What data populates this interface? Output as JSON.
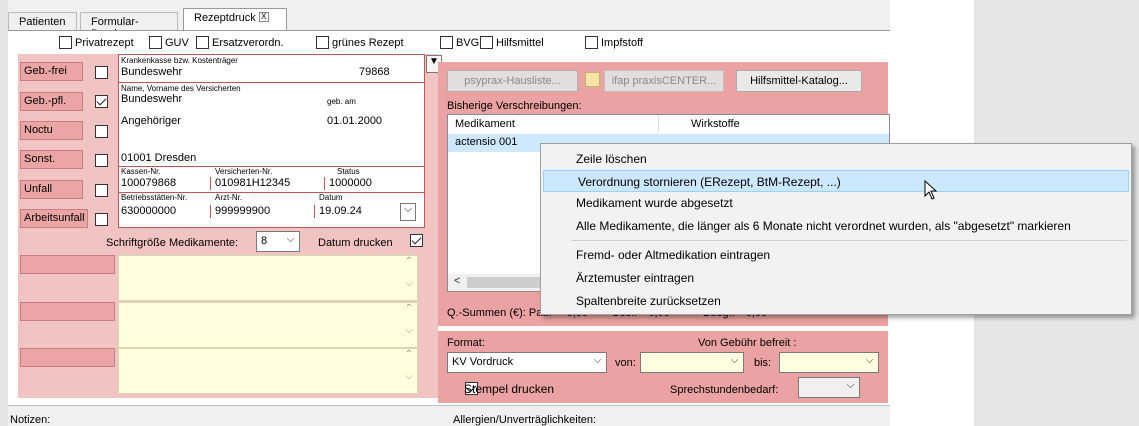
{
  "tabs": [
    "Patienten",
    "Formular-Druck",
    "Rezeptdruck"
  ],
  "tab_close": "X",
  "top_checks": [
    {
      "label": "Privatrezept",
      "checked": false
    },
    {
      "label": "GUV",
      "checked": false
    },
    {
      "label": "Ersatzverordn.",
      "checked": false
    },
    {
      "label": "grünes Rezept",
      "checked": false
    },
    {
      "label": "BVG",
      "checked": false
    },
    {
      "label": "Hilfsmittel",
      "checked": false
    },
    {
      "label": "Impfstoff",
      "checked": false
    }
  ],
  "side_buttons": [
    {
      "label": "Geb.-frei",
      "checked": false
    },
    {
      "label": "Geb.-pfl.",
      "checked": true
    },
    {
      "label": "Noctu",
      "checked": false
    },
    {
      "label": "Sonst.",
      "checked": false
    },
    {
      "label": "Unfall",
      "checked": false
    },
    {
      "label": "Arbeitsunfall",
      "checked": false
    }
  ],
  "form": {
    "kasse_label": "Krankenkasse bzw. Kostenträger",
    "kasse_value": "Bundeswehr",
    "kasse_nr": "79868",
    "name_label": "Name, Vorname des Versicherten",
    "name_value": "Bundeswehr",
    "geb_label": "geb. am",
    "vorname_value": "Angehöriger",
    "geb_value": "01.01.2000",
    "ort_value": "01001 Dresden",
    "kassennr_label": "Kassen-Nr.",
    "kassennr_value": "100079868",
    "versnr_label": "Versicherten-Nr.",
    "versnr_value": "010981H12345",
    "status_label": "Status",
    "status_value": "1000000",
    "bsnr_label": "Betriebsstätten-Nr.",
    "bsnr_value": "630000000",
    "arztnr_label": "Arzt-Nr.",
    "arztnr_value": "999999900",
    "datum_label": "Datum",
    "datum_value": "19.09.24"
  },
  "font_size_label": "Schriftgröße Medikamente:",
  "font_size_value": "8",
  "datum_drucken_label": "Datum drucken",
  "datum_drucken_checked": true,
  "right_buttons": {
    "psyprax": "psyprax-Hausliste...",
    "ifap": "ifap praxisCENTER...",
    "hilfsmittel": "Hilfsmittel-Katalog..."
  },
  "bisherige_label": "Bisherige Verschreibungen:",
  "grid_headers": [
    "Medikament",
    "Wirkstoffe"
  ],
  "grid_rows": [
    [
      "actensio 001",
      ""
    ]
  ],
  "summen": {
    "label": "Q.-Summen (€): Pat.:",
    "pat": "0,00",
    "ges_label": "Ges.:",
    "ges": "0,00",
    "budg_label": "Budg.:",
    "budg": "0,00"
  },
  "format_label": "Format:",
  "format_value": "KV Vordruck",
  "gebuehr_label": "Von Gebühr befreit :",
  "von_label": "von:",
  "bis_label": "bis:",
  "stempel_label": "Stempel drucken",
  "stempel_checked": true,
  "sprechstunden_label": "Sprechstundenbedarf:",
  "context_menu": [
    {
      "label": "Zeile löschen",
      "highlight": false
    },
    {
      "label": "Verordnung stornieren (ERezept, BtM-Rezept, ...)",
      "highlight": true
    },
    {
      "label": "Medikament wurde abgesetzt",
      "highlight": false
    },
    {
      "label": "Alle Medikamente, die länger als 6 Monate nicht verordnet wurden, als \"abgesetzt\" markieren",
      "highlight": false
    },
    {
      "label": "Fremd- oder Altmedikation eintragen",
      "highlight": false
    },
    {
      "label": "Ärztemuster eintragen",
      "highlight": false
    },
    {
      "label": "Spaltenbreite zurücksetzen",
      "highlight": false
    }
  ],
  "footer": {
    "notizen": "Notizen:",
    "allergien": "Allergien/Unverträglichkeiten:"
  },
  "colors": {
    "panel_pink": "#f2c3c3",
    "button_red": "#eba5a5",
    "menu_highlight": "#cce8ff"
  }
}
